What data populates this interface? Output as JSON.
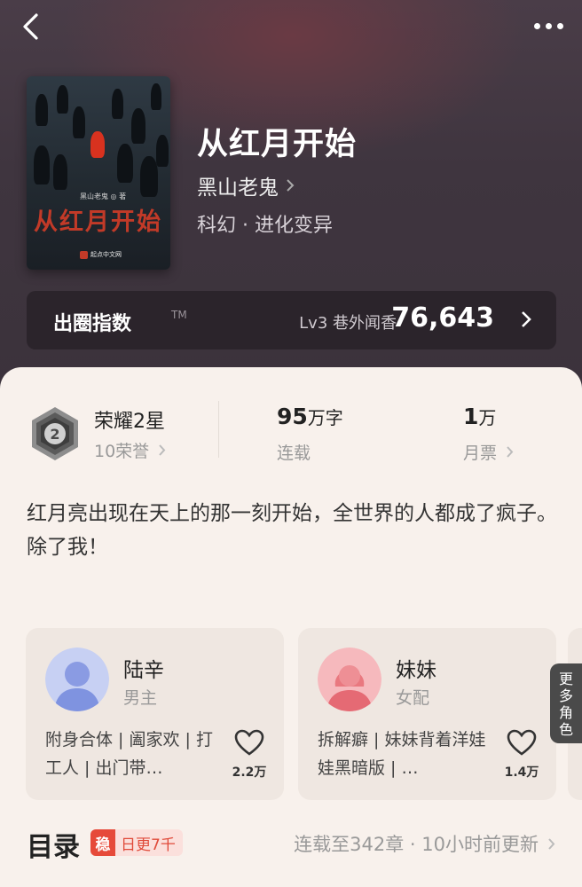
{
  "header": {
    "back_icon": "back-arrow-icon",
    "more_icon": "more-dots-icon"
  },
  "book": {
    "title": "从红月开始",
    "author": "黑山老鬼",
    "genre": "科幻 · 进化变异",
    "cover": {
      "title": "从红月开始",
      "author": "黑山老鬼 ◎ 著",
      "publisher": "起点中文网"
    }
  },
  "influence": {
    "label": "出圈指数",
    "tm": "TM",
    "level": "Lv3 巷外闻香",
    "value": "76,643"
  },
  "honor": {
    "title": "荣耀2星",
    "sub": "10荣誉",
    "medal_number": "2"
  },
  "stats": [
    {
      "value": "95",
      "unit": "万字",
      "label": "连载"
    },
    {
      "value": "1",
      "unit": "万",
      "label": "月票"
    }
  ],
  "synopsis": [
    "红月亮出现在天上的那一刻开始，全世界的人都成了疯子。",
    "除了我！"
  ],
  "characters": [
    {
      "name": "陆辛",
      "role": "男主",
      "tags": "附身合体 | 阖家欢 | 打工人 | 出门带…",
      "likes": "2.2万",
      "accent": "#7f93e0"
    },
    {
      "name": "妹妹",
      "role": "女配",
      "tags": "拆解癖 | 妹妹背着洋娃娃黑暗版 | …",
      "likes": "1.4万",
      "accent": "#e56a74"
    }
  ],
  "more_roles": [
    "更",
    "多",
    "角",
    "色"
  ],
  "toc": {
    "title": "目录",
    "badge_icon": "稳",
    "badge_text": "日更7千",
    "update": "连载至342章 · 10小时前更新"
  }
}
